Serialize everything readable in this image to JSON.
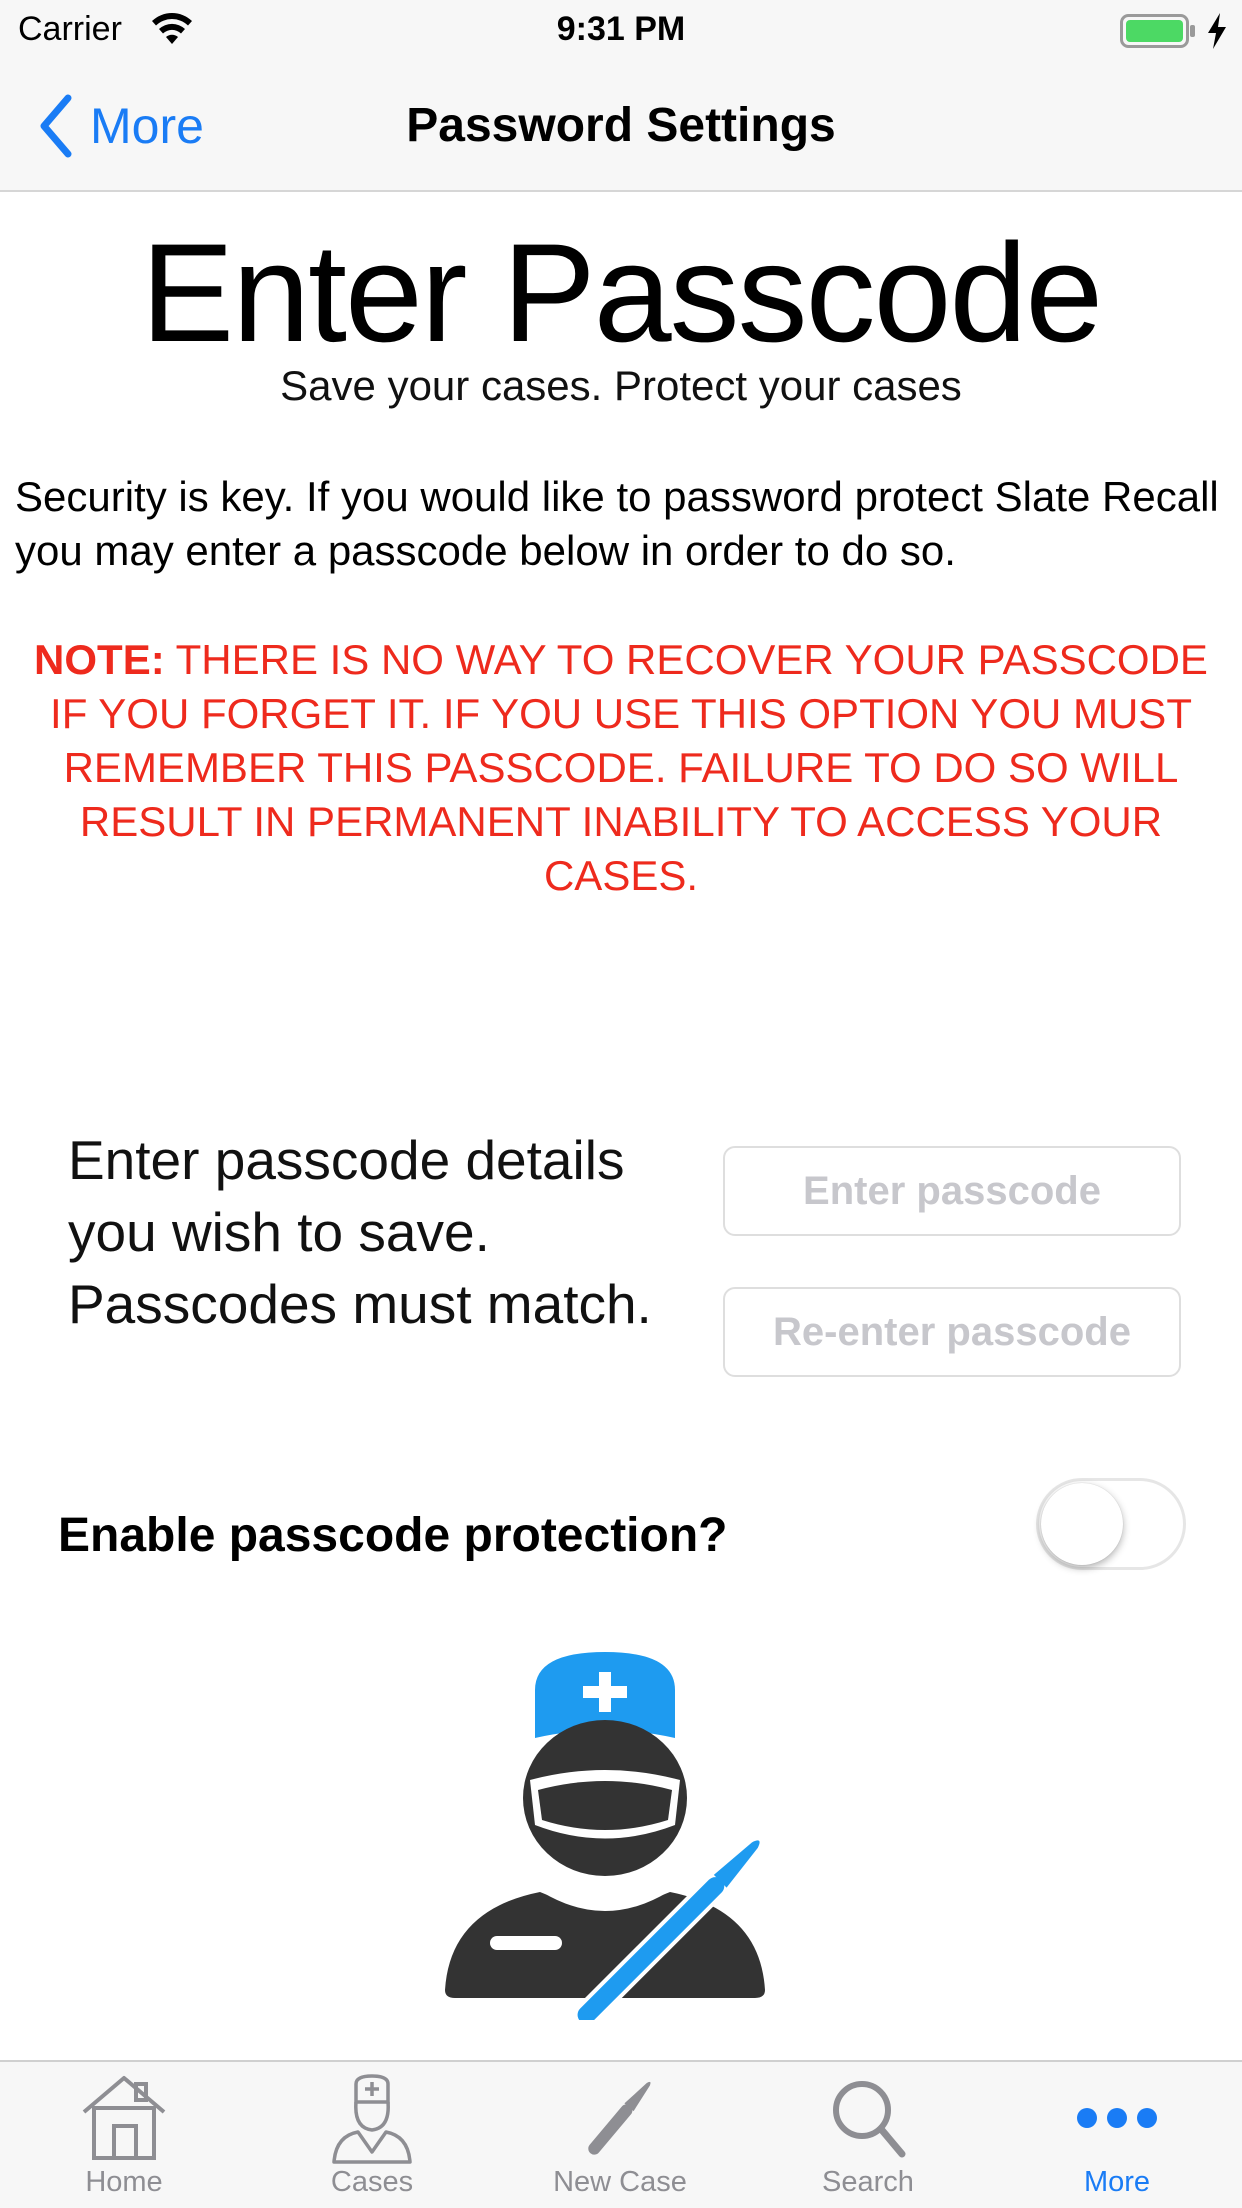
{
  "status_bar": {
    "carrier": "Carrier",
    "time": "9:31 PM"
  },
  "nav": {
    "back_label": "More",
    "title": "Password Settings"
  },
  "hero": {
    "title": "Enter Passcode",
    "subtitle": "Save your cases. Protect your cases"
  },
  "intro": "Security is key. If you would like to password protect Slate Recall you may enter a passcode below in order to do so.",
  "note": {
    "label": "NOTE:",
    "text": " THERE IS NO WAY TO RECOVER YOUR PASSCODE IF YOU FORGET IT. IF YOU USE THIS OPTION YOU MUST REMEMBER THIS PASSCODE. FAILURE TO DO SO WILL RESULT IN PERMANENT INABILITY TO ACCESS YOUR CASES."
  },
  "passcode": {
    "instructions": "Enter passcode details you wish to save. Passcodes must match.",
    "field1_placeholder": "Enter passcode",
    "field2_placeholder": "Re-enter passcode",
    "field1_value": "",
    "field2_value": ""
  },
  "protection": {
    "label": "Enable passcode protection?",
    "enabled": false
  },
  "tab_bar": {
    "tabs": [
      {
        "label": "Home",
        "icon": "home-icon",
        "active": false
      },
      {
        "label": "Cases",
        "icon": "doctor-icon",
        "active": false
      },
      {
        "label": "New Case",
        "icon": "scalpel-icon",
        "active": false
      },
      {
        "label": "Search",
        "icon": "search-icon",
        "active": false
      },
      {
        "label": "More",
        "icon": "more-icon",
        "active": true
      }
    ]
  },
  "colors": {
    "accent_blue": "#1a7cf5",
    "warning_red": "#ee2a1d",
    "illustration_blue": "#1e9bf0",
    "illustration_dark": "#333333",
    "battery_green": "#4cd964"
  }
}
